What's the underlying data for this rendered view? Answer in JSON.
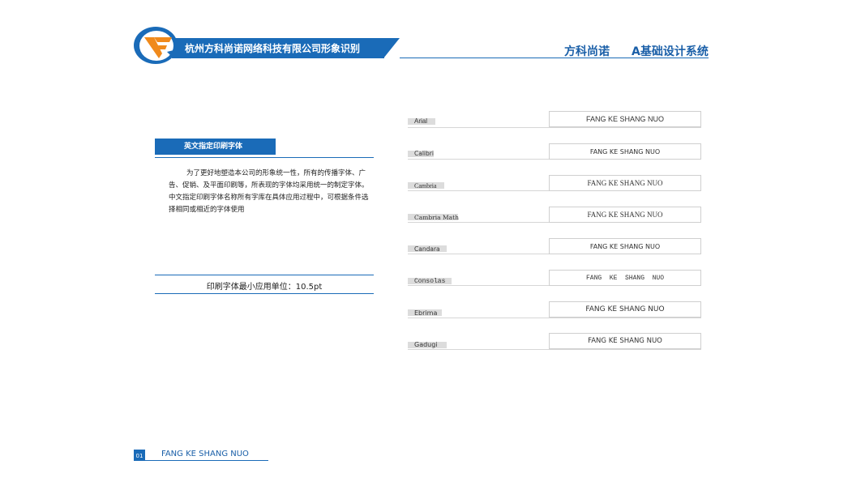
{
  "header": {
    "title": "杭州方科尚诺网络科技有限公司形象识别",
    "brand": "方科尚诺",
    "system": "A基础设计系统"
  },
  "section": {
    "label": "英文指定印刷字体",
    "description": "为了更好地塑造本公司的形象统一性，所有的传播字体、广告、促销、及平面印刷等，所表现的字体均采用统一的制定字体。中文指定印刷字体名称所有字库在具体应用过程中，可根据条件选择相同或相近的字体使用",
    "min_size": "印刷字体最小应用单位：10.5pt"
  },
  "fonts": [
    {
      "name": "Arial",
      "sample": "FANG KE SHANG NUO"
    },
    {
      "name": "Calibri",
      "sample": "FANG KE SHANG NUO"
    },
    {
      "name": "Cambria",
      "sample": "FANG KE SHANG NUO"
    },
    {
      "name": "Cambria Math",
      "sample": "FANG KE SHANG NUO"
    },
    {
      "name": "Candara",
      "sample": "FANG KE SHANG NUO"
    },
    {
      "name": "Consolas",
      "sample": "FANG  KE  SHANG  NUO"
    },
    {
      "name": "Ebrima",
      "sample": "FANG KE SHANG NUO"
    },
    {
      "name": "Gadugi",
      "sample": "FANG KE SHANG NUO"
    }
  ],
  "footer": {
    "page": "01",
    "text": "FANG KE SHANG NUO"
  },
  "colors": {
    "brand_blue": "#1a6bb8",
    "logo_orange": "#f08a1c"
  }
}
